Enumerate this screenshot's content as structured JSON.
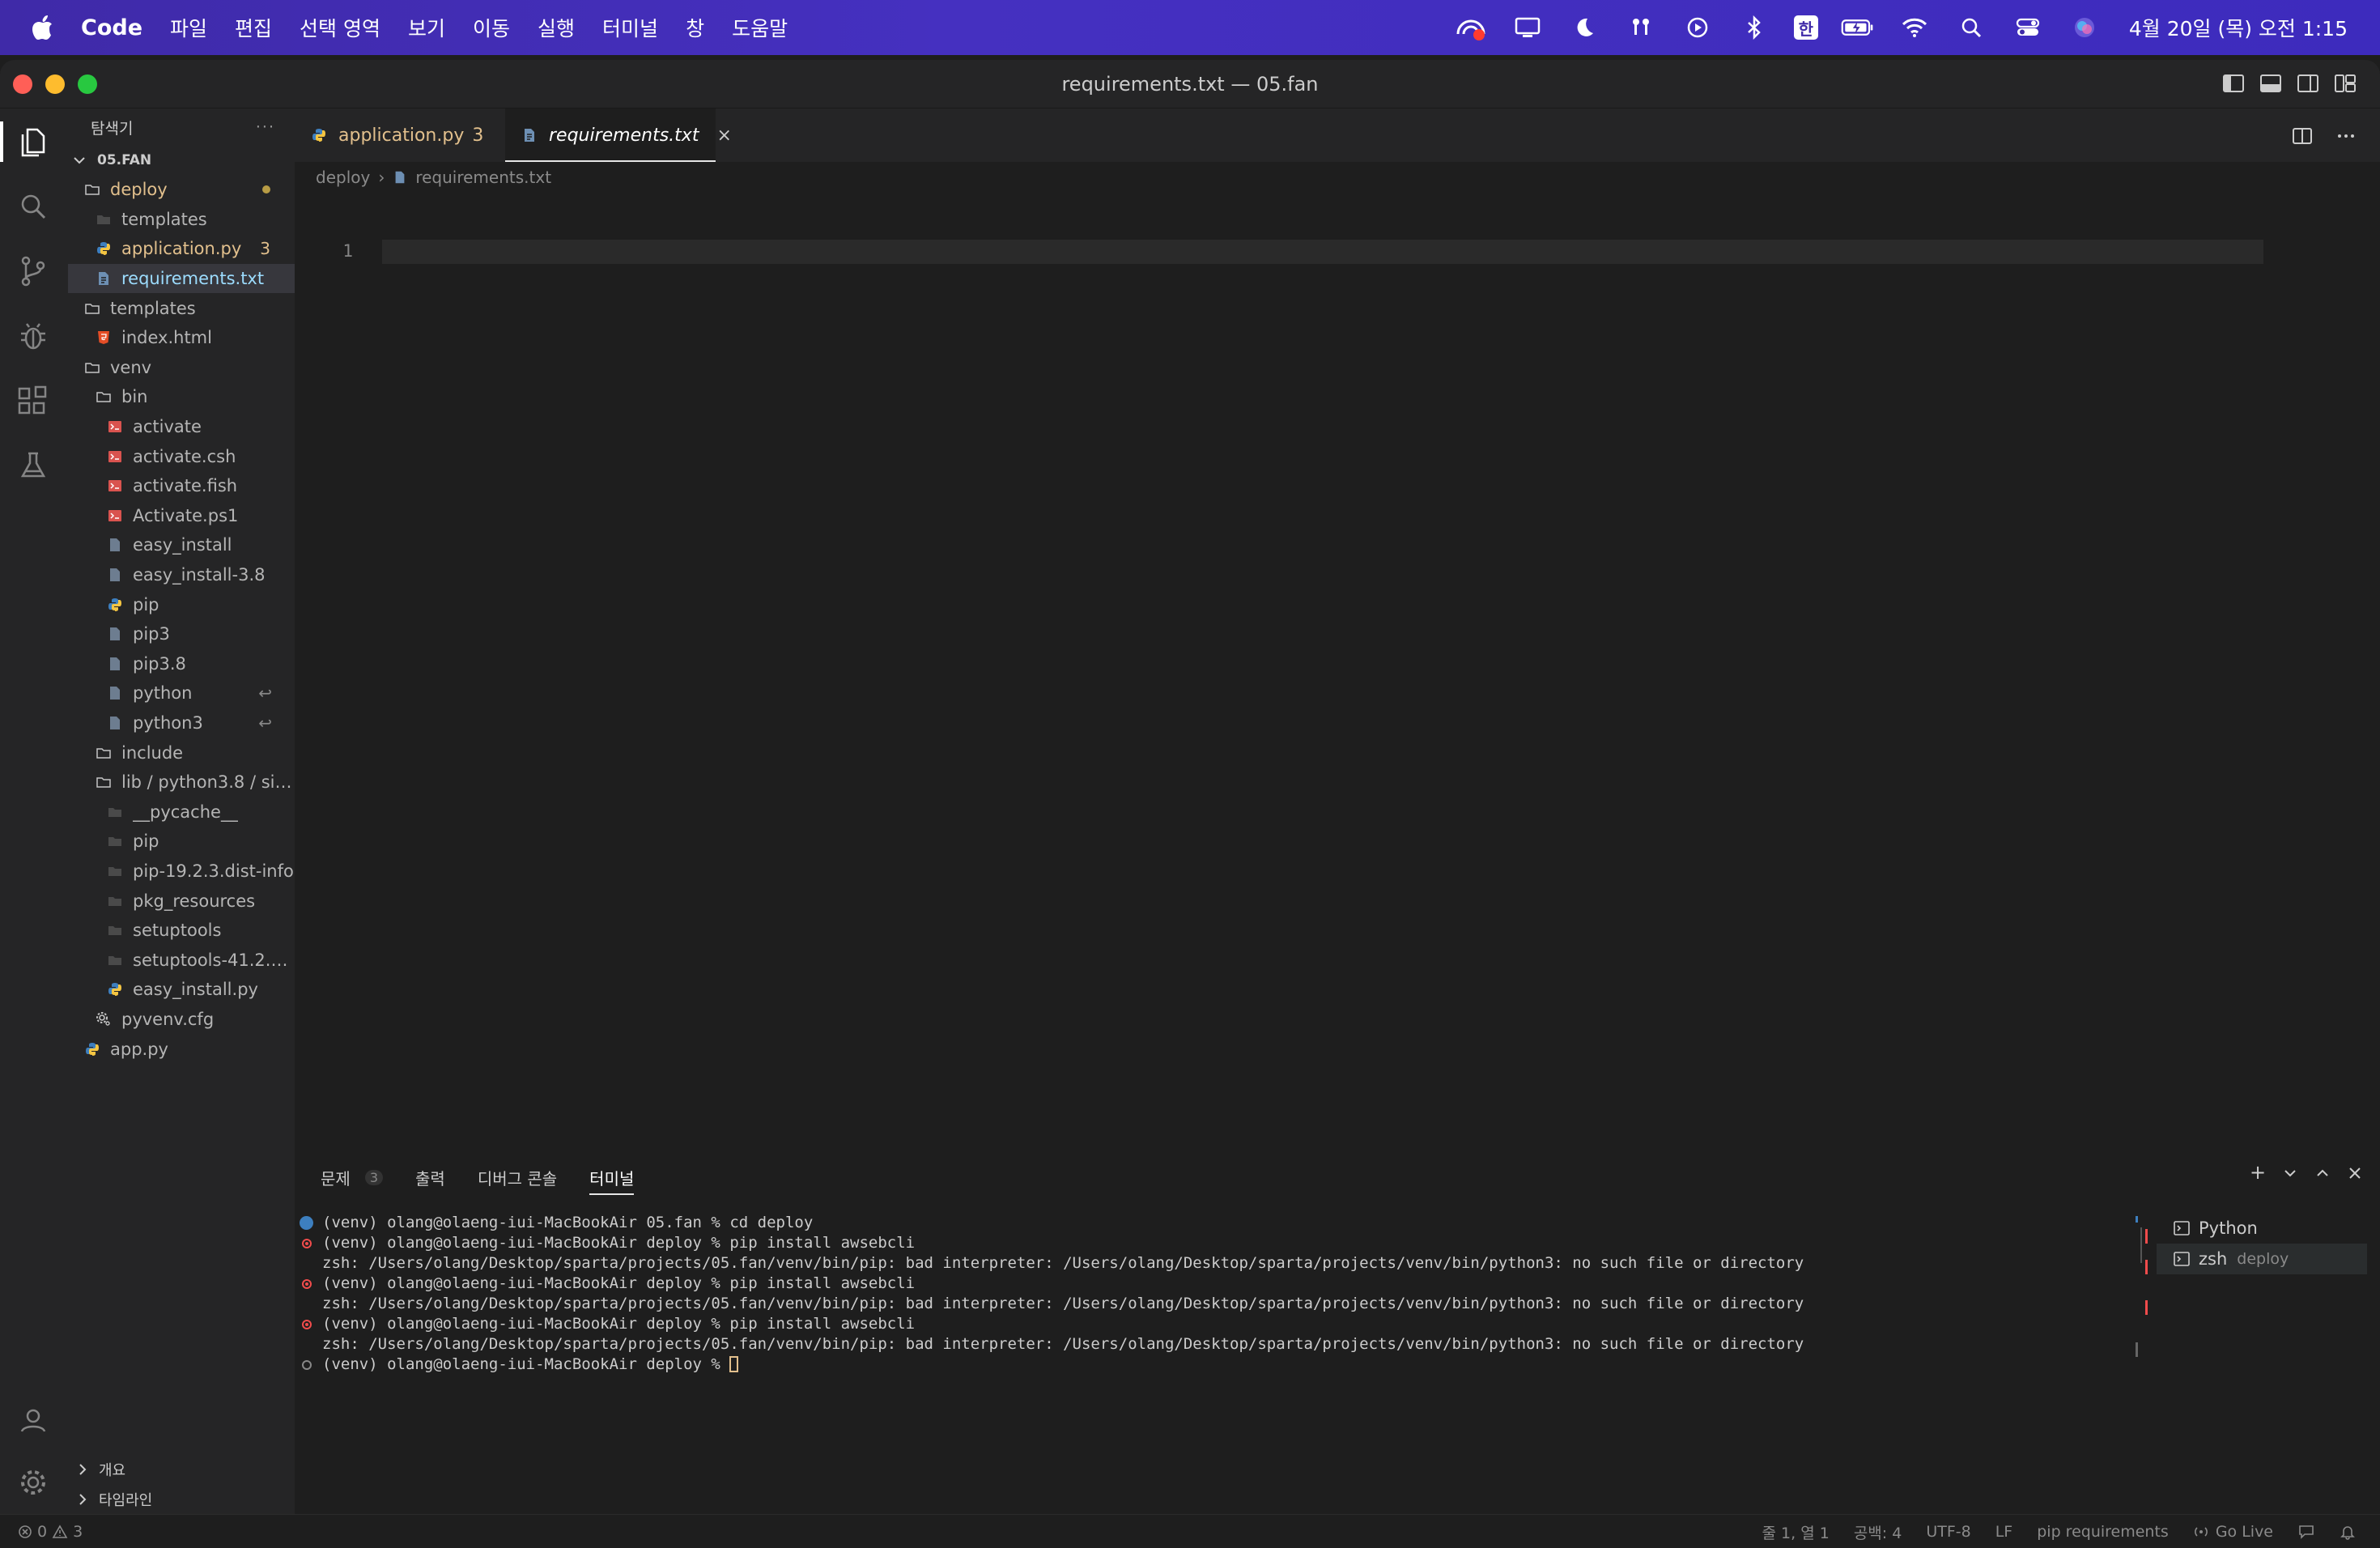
{
  "menubar": {
    "app_name": "Code",
    "items": [
      "파일",
      "편집",
      "선택 영역",
      "보기",
      "이동",
      "실행",
      "터미널",
      "창",
      "도움말"
    ],
    "ime": "한",
    "clock": "4월 20일 (목) 오전 1:15"
  },
  "window": {
    "title": "requirements.txt — 05.fan"
  },
  "sidebar": {
    "title": "탐색기",
    "more": "···",
    "root": "05.FAN",
    "tree": [
      {
        "label": "deploy",
        "kind": "folder",
        "depth": 0,
        "modified": true
      },
      {
        "label": "templates",
        "kind": "folder-dim",
        "depth": 1
      },
      {
        "label": "application.py",
        "kind": "python",
        "depth": 1,
        "badge": "3"
      },
      {
        "label": "requirements.txt",
        "kind": "file",
        "depth": 1,
        "selected": true
      },
      {
        "label": "templates",
        "kind": "folder",
        "depth": 0
      },
      {
        "label": "index.html",
        "kind": "html",
        "depth": 1
      },
      {
        "label": "venv",
        "kind": "folder",
        "depth": 0
      },
      {
        "label": "bin",
        "kind": "folder",
        "depth": 1
      },
      {
        "label": "activate",
        "kind": "shell",
        "depth": 2
      },
      {
        "label": "activate.csh",
        "kind": "shell",
        "depth": 2
      },
      {
        "label": "activate.fish",
        "kind": "shell",
        "depth": 2
      },
      {
        "label": "Activate.ps1",
        "kind": "shell",
        "depth": 2
      },
      {
        "label": "easy_install",
        "kind": "generic",
        "depth": 2
      },
      {
        "label": "easy_install-3.8",
        "kind": "generic",
        "depth": 2
      },
      {
        "label": "pip",
        "kind": "python",
        "depth": 2
      },
      {
        "label": "pip3",
        "kind": "generic",
        "depth": 2
      },
      {
        "label": "pip3.8",
        "kind": "generic",
        "depth": 2
      },
      {
        "label": "python",
        "kind": "generic",
        "depth": 2,
        "symlink": "↩"
      },
      {
        "label": "python3",
        "kind": "generic",
        "depth": 2,
        "symlink": "↩"
      },
      {
        "label": "include",
        "kind": "folder",
        "depth": 1
      },
      {
        "label": "lib / python3.8 / site...",
        "kind": "folder",
        "depth": 1
      },
      {
        "label": "__pycache__",
        "kind": "folder-dim",
        "depth": 2
      },
      {
        "label": "pip",
        "kind": "folder-dim",
        "depth": 2
      },
      {
        "label": "pip-19.2.3.dist-info",
        "kind": "folder-dim",
        "depth": 2
      },
      {
        "label": "pkg_resources",
        "kind": "folder-dim",
        "depth": 2
      },
      {
        "label": "setuptools",
        "kind": "folder-dim",
        "depth": 2
      },
      {
        "label": "setuptools-41.2.0...",
        "kind": "folder-dim",
        "depth": 2
      },
      {
        "label": "easy_install.py",
        "kind": "python",
        "depth": 2
      },
      {
        "label": "pyvenv.cfg",
        "kind": "config",
        "depth": 1
      },
      {
        "label": "app.py",
        "kind": "python",
        "depth": 0
      }
    ],
    "outline_label": "개요",
    "timeline_label": "타임라인"
  },
  "tabs": {
    "application": {
      "label": "application.py",
      "badge": "3"
    },
    "requirements": {
      "label": "requirements.txt",
      "close": "×"
    }
  },
  "breadcrumb": {
    "folder": "deploy",
    "sep": "›",
    "file": "requirements.txt"
  },
  "editor": {
    "line_number": "1"
  },
  "panel": {
    "tabs": {
      "problems": "문제",
      "problems_count": "3",
      "output": "출력",
      "debug": "디버그 콘솔",
      "terminal": "터미널"
    },
    "actions": {
      "add": "+"
    },
    "terminal_lines": [
      {
        "mark": "blue",
        "text": "(venv) olang@olaeng-iui-MacBookAir 05.fan % cd deploy"
      },
      {
        "mark": "err",
        "text": "(venv) olang@olaeng-iui-MacBookAir deploy % pip install awsebcli"
      },
      {
        "mark": "",
        "text": "zsh: /Users/olang/Desktop/sparta/projects/05.fan/venv/bin/pip: bad interpreter: /Users/olang/Desktop/sparta/projects/venv/bin/python3: no such file or directory"
      },
      {
        "mark": "err",
        "text": "(venv) olang@olaeng-iui-MacBookAir deploy % pip install awsebcli"
      },
      {
        "mark": "",
        "text": "zsh: /Users/olang/Desktop/sparta/projects/05.fan/venv/bin/pip: bad interpreter: /Users/olang/Desktop/sparta/projects/venv/bin/python3: no such file or directory"
      },
      {
        "mark": "err",
        "text": "(venv) olang@olaeng-iui-MacBookAir deploy % pip install awsebcli"
      },
      {
        "mark": "",
        "text": "zsh: /Users/olang/Desktop/sparta/projects/05.fan/venv/bin/pip: bad interpreter: /Users/olang/Desktop/sparta/projects/venv/bin/python3: no such file or directory"
      },
      {
        "mark": "idle",
        "text": "(venv) olang@olaeng-iui-MacBookAir deploy % ",
        "cursor": true
      }
    ],
    "terminals": [
      {
        "name": "Python",
        "sub": ""
      },
      {
        "name": "zsh",
        "sub": "deploy"
      }
    ]
  },
  "statusbar": {
    "errors": "0",
    "warnings": "3",
    "position": "줄 1, 열 1",
    "spaces": "공백: 4",
    "encoding": "UTF-8",
    "eol": "LF",
    "language": "pip requirements",
    "golive": "Go Live"
  },
  "colors": {
    "accent_purple": "#3f2aa8",
    "modified": "#e2c08d",
    "error": "#f14c4c",
    "python_blue": "#3d7fbf"
  }
}
